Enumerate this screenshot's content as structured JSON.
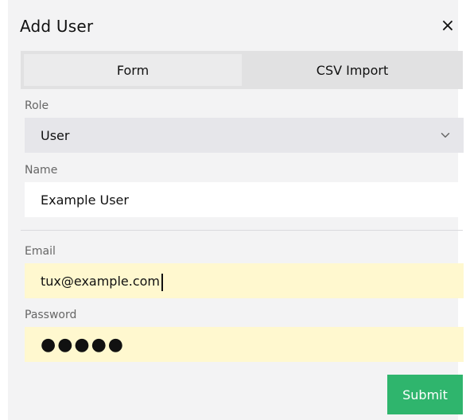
{
  "dialog": {
    "title": "Add User",
    "close_label": "×"
  },
  "tabs": [
    {
      "label": "Form",
      "active": true
    },
    {
      "label": "CSV Import",
      "active": false
    }
  ],
  "form": {
    "role": {
      "label": "Role",
      "value": "User"
    },
    "name": {
      "label": "Name",
      "value": "Example User"
    },
    "email": {
      "label": "Email",
      "value": "tux@example.com"
    },
    "password": {
      "label": "Password",
      "value": "●●●●●"
    }
  },
  "actions": {
    "submit_label": "Submit"
  },
  "colors": {
    "submit_bg": "#2fb56d",
    "autofill_yellow": "#fff8cf"
  },
  "icons": {
    "close": "close-icon",
    "select": "chevron-down-icon"
  }
}
